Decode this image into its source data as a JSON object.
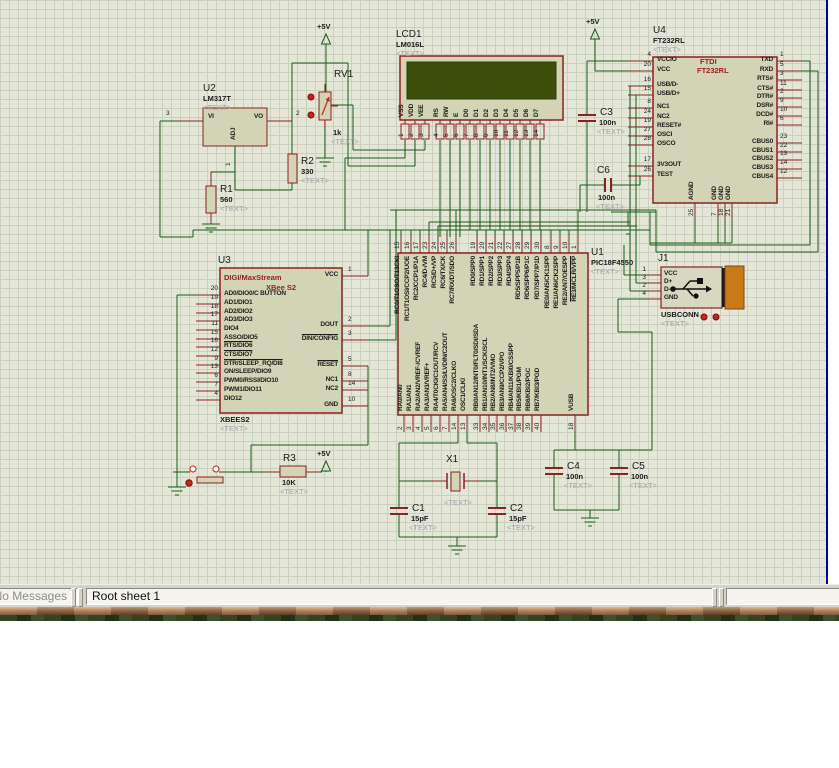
{
  "placeholder": "<TEXT>",
  "power_label": "+5V",
  "status": {
    "left_text": "No Messages",
    "sheet": "Root sheet 1"
  },
  "colors": {
    "wire_green": "#175c17",
    "component_maroon": "#8b2121",
    "body_fill": "#d3d3b5",
    "accent_red": "#cc2020",
    "lcd_screen": "#3c4e0a",
    "usb_orange": "#c67a18",
    "grid_bg": "#e4e6d8",
    "window_edge_blue": "#0000a8"
  },
  "components": {
    "U2": {
      "ref": "U2",
      "value": "LM317T",
      "inner": {
        "left": "VI",
        "right": "VO",
        "bottom": "ADJ"
      },
      "pin_numbers": {
        "left": "3",
        "right": "2",
        "bottom": "1"
      }
    },
    "R1": {
      "ref": "R1",
      "value": "560"
    },
    "R2": {
      "ref": "R2",
      "value": "330"
    },
    "R3": {
      "ref": "R3",
      "value": "10K"
    },
    "RV1": {
      "ref": "RV1",
      "value": "1k"
    },
    "LCD1": {
      "ref": "LCD1",
      "value": "LM016L",
      "pins": [
        {
          "n": "1",
          "l": "VSS"
        },
        {
          "n": "2",
          "l": "VDD"
        },
        {
          "n": "3",
          "l": "VEE"
        },
        {
          "n": "4",
          "l": "RS"
        },
        {
          "n": "5",
          "l": "RW"
        },
        {
          "n": "6",
          "l": "E"
        },
        {
          "n": "7",
          "l": "D0"
        },
        {
          "n": "8",
          "l": "D1"
        },
        {
          "n": "9",
          "l": "D2"
        },
        {
          "n": "10",
          "l": "D3"
        },
        {
          "n": "11",
          "l": "D4"
        },
        {
          "n": "12",
          "l": "D5"
        },
        {
          "n": "13",
          "l": "D6"
        },
        {
          "n": "14",
          "l": "D7"
        }
      ]
    },
    "U3": {
      "ref": "U3",
      "titles": [
        "DIGI/MaxStream",
        "XBee S2"
      ],
      "value": "XBEES2",
      "left": [
        {
          "n": "20",
          "l": "AD0/DIO0/C BUTTON"
        },
        {
          "n": "19",
          "l": "AD1/DIO1"
        },
        {
          "n": "18",
          "l": "AD2/DIO2"
        },
        {
          "n": "17",
          "l": "AD3/DIO3"
        },
        {
          "n": "11",
          "l": "DIO4"
        },
        {
          "n": "15",
          "l": "ASSO/DIO5"
        },
        {
          "n": "16",
          "l": "RTS/DIO6",
          "ol": true
        },
        {
          "n": "12",
          "l": "CTS/DIO7",
          "ol": true
        },
        {
          "n": "9",
          "l": "DTR/SLEEP_RQ/DI8",
          "ol": true
        },
        {
          "n": "13",
          "l": "ON/SLEEP/DIO9"
        },
        {
          "n": "6",
          "l": "PWM0/RSSI/DIO10"
        },
        {
          "n": "7",
          "l": "PWM1/DIO11"
        },
        {
          "n": "4",
          "l": "DIO12"
        }
      ],
      "right": [
        {
          "n": "1",
          "l": "VCC"
        },
        {
          "n": "2",
          "l": "DOUT"
        },
        {
          "n": "3",
          "l": "DIN/CONFIG",
          "ol": true
        },
        {
          "n": "5",
          "l": "RESET",
          "ol": true
        },
        {
          "n": "8",
          "l": "NC1"
        },
        {
          "n": "14",
          "l": "NC2"
        },
        {
          "n": "10",
          "l": "GND"
        }
      ]
    },
    "U1": {
      "ref": "U1",
      "value": "PIC18F4550",
      "top": [
        {
          "n": "15",
          "l": "RC0/T1OSO/T13CKI"
        },
        {
          "n": "16",
          "l": "RC1/T1OSI/CCP2/UOE"
        },
        {
          "n": "17",
          "l": "RC2/CCP1/P1A"
        },
        {
          "n": "23",
          "l": "RC4/D-/VM"
        },
        {
          "n": "24",
          "l": "RC5/D+/VP"
        },
        {
          "n": "25",
          "l": "RC6/TX/CK"
        },
        {
          "n": "26",
          "l": "RC7/RX/DT/SDO"
        },
        {
          "n": "19",
          "l": "RD0/SPP0"
        },
        {
          "n": "20",
          "l": "RD1/SPP1"
        },
        {
          "n": "21",
          "l": "RD2/SPP2"
        },
        {
          "n": "22",
          "l": "RD3/SPP3"
        },
        {
          "n": "27",
          "l": "RD4/SPP4"
        },
        {
          "n": "28",
          "l": "RD5/SPP5/P1B"
        },
        {
          "n": "29",
          "l": "RD6/SPP6/P1C"
        },
        {
          "n": "30",
          "l": "RD7/SPP7/P1D"
        },
        {
          "n": "8",
          "l": "RE0/AN5/CK1SPP"
        },
        {
          "n": "9",
          "l": "RE1/AN6/CK2SPP"
        },
        {
          "n": "10",
          "l": "RE2/AN7/OESPP"
        },
        {
          "n": "1",
          "l": "RE3/MCLR/VPP",
          "ol": true
        }
      ],
      "bottom": [
        {
          "n": "2",
          "l": "RA0/AN0"
        },
        {
          "n": "3",
          "l": "RA1/AN1"
        },
        {
          "n": "4",
          "l": "RA2/AN2/VREF-/CVREF"
        },
        {
          "n": "5",
          "l": "RA3/AN3/VREF+"
        },
        {
          "n": "6",
          "l": "RA4/T0CKI/C1OUT/RCV"
        },
        {
          "n": "7",
          "l": "RA5/AN4/SS/LVDIN/C2OUT"
        },
        {
          "n": "14",
          "l": "RA6/OSC2/CLKO"
        },
        {
          "n": "13",
          "l": "OSC1/CLKI"
        },
        {
          "n": "33",
          "l": "RB0/AN12/INT0/FLT0/SDI/SDA"
        },
        {
          "n": "34",
          "l": "RB1/AN10/INT1/SCK/SCL"
        },
        {
          "n": "35",
          "l": "RB2/AN8/INT2/VMO"
        },
        {
          "n": "36",
          "l": "RB3/AN9/CCP2/VPO"
        },
        {
          "n": "37",
          "l": "RB4/AN11/KBI0/CSSPP"
        },
        {
          "n": "38",
          "l": "RB5/KBI1/PGM"
        },
        {
          "n": "39",
          "l": "RB6/KBI2/PGC"
        },
        {
          "n": "40",
          "l": "RB7/KBI3/PGD"
        },
        {
          "n": "18",
          "l": "VUSB"
        }
      ]
    },
    "U4": {
      "ref": "U4",
      "value": "FT232RL",
      "inner": [
        "FTDI",
        "FT232RL"
      ],
      "left": [
        {
          "n": "4",
          "l": "VCCIO"
        },
        {
          "n": "20",
          "l": "VCC"
        },
        {
          "n": "16",
          "l": "USB/D-"
        },
        {
          "n": "15",
          "l": "USB/D+"
        },
        {
          "n": "8",
          "l": "NC1"
        },
        {
          "n": "24",
          "l": "NC2"
        },
        {
          "n": "19",
          "l": "RESET#"
        },
        {
          "n": "27",
          "l": "OSCI"
        },
        {
          "n": "28",
          "l": "OSCO"
        },
        {
          "n": "17",
          "l": "3V3OUT"
        },
        {
          "n": "26",
          "l": "TEST"
        }
      ],
      "right": [
        {
          "n": "1",
          "l": "TXD"
        },
        {
          "n": "5",
          "l": "RXD"
        },
        {
          "n": "3",
          "l": "RTS#"
        },
        {
          "n": "11",
          "l": "CTS#"
        },
        {
          "n": "2",
          "l": "DTR#"
        },
        {
          "n": "9",
          "l": "DSR#"
        },
        {
          "n": "10",
          "l": "DCD#"
        },
        {
          "n": "6",
          "l": "RI#"
        },
        {
          "n": "23",
          "l": "CBUS0"
        },
        {
          "n": "22",
          "l": "CBUS1"
        },
        {
          "n": "13",
          "l": "CBUS2"
        },
        {
          "n": "14",
          "l": "CBUS3"
        },
        {
          "n": "12",
          "l": "CBUS4"
        }
      ],
      "bottom": [
        {
          "n": "25",
          "l": "AGND"
        },
        {
          "n": "7",
          "l": "GND"
        },
        {
          "n": "18",
          "l": "GND"
        },
        {
          "n": "21",
          "l": "GND"
        }
      ]
    },
    "J1": {
      "ref": "J1",
      "value": "USBCONN",
      "pins": [
        {
          "n": "1",
          "l": "VCC"
        },
        {
          "n": "3",
          "l": "D+"
        },
        {
          "n": "2",
          "l": "D-"
        },
        {
          "n": "4",
          "l": "GND"
        }
      ]
    },
    "X1": {
      "ref": "X1"
    },
    "C1": {
      "ref": "C1",
      "value": "15pF"
    },
    "C2": {
      "ref": "C2",
      "value": "15pF"
    },
    "C3": {
      "ref": "C3",
      "value": "100n"
    },
    "C4": {
      "ref": "C4",
      "value": "100n"
    },
    "C5": {
      "ref": "C5",
      "value": "100n"
    },
    "C6": {
      "ref": "C6",
      "value": "100n"
    }
  }
}
